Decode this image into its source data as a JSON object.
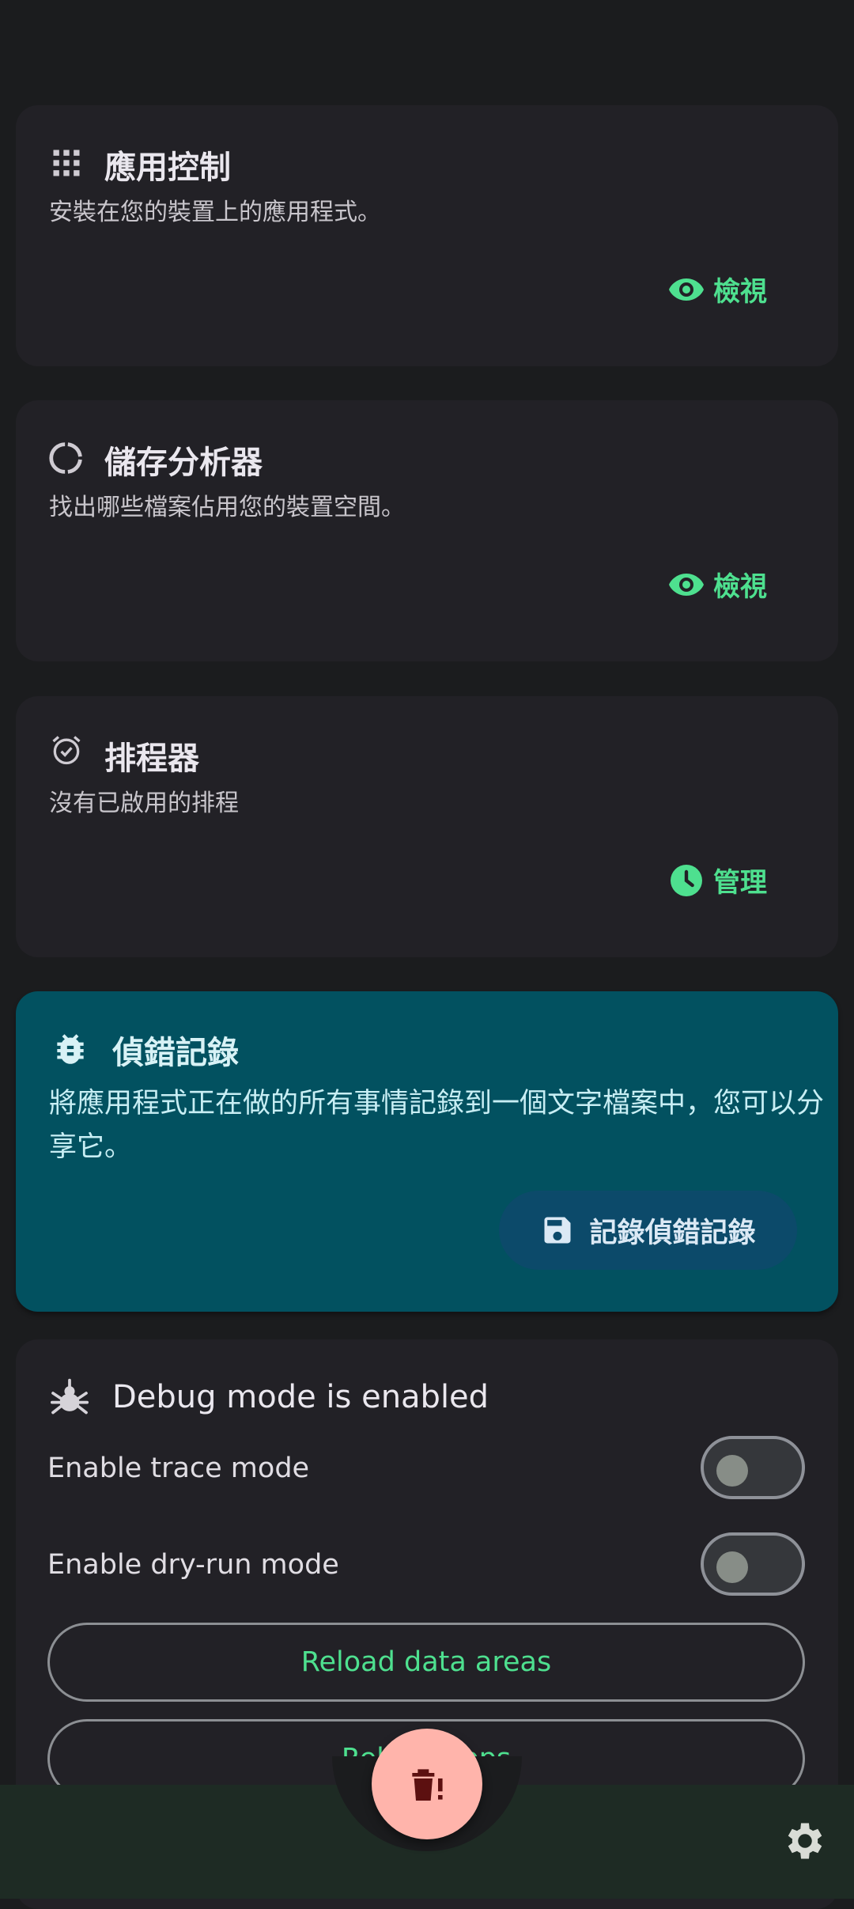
{
  "cards": {
    "app_manager": {
      "title": "應用控制",
      "description": "安裝在您的裝置上的應用程式。",
      "action": "檢視"
    },
    "storage": {
      "title": "儲存分析器",
      "description": "找出哪些檔案佔用您的裝置空間。",
      "action": "檢視"
    },
    "scheduler": {
      "title": "排程器",
      "description": "沒有已啟用的排程",
      "action": "管理"
    }
  },
  "debug_log": {
    "title": "偵錯記錄",
    "description": "將應用程式正在做的所有事情記錄到一個文字檔案中，您可以分享它。",
    "button": "記錄偵錯記錄"
  },
  "developer": {
    "title": "Debug mode is enabled",
    "trace_label": "Enable trace mode",
    "trace_enabled": false,
    "dryrun_label": "Enable dry-run mode",
    "dryrun_enabled": false,
    "reload_data": "Reload data areas",
    "reload_apps": "Reload apps"
  },
  "icons": {
    "fab": "delete-warning-icon",
    "settings": "gear-icon"
  },
  "colors": {
    "accent": "#4ee08f",
    "debug_card": "#025160",
    "fab": "#ffb4ab"
  }
}
